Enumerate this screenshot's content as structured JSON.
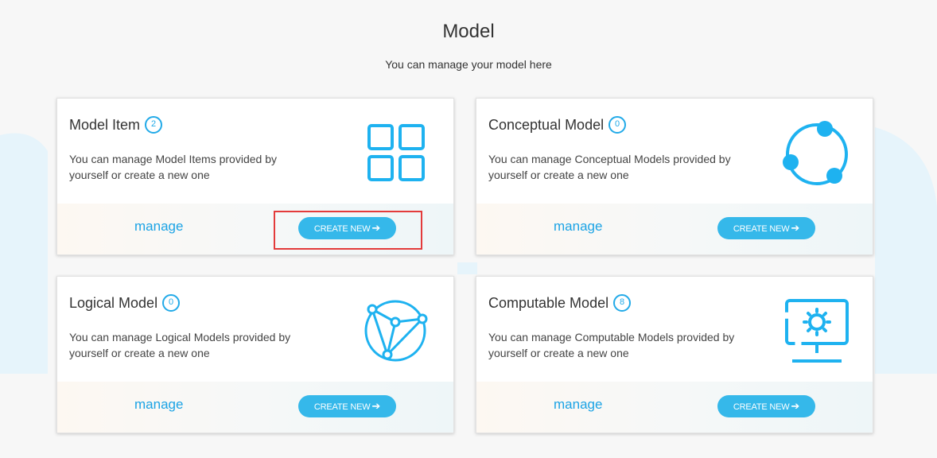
{
  "header": {
    "title": "Model",
    "subtitle": "You can manage your model here"
  },
  "cards": [
    {
      "title": "Model Item",
      "count": "2",
      "description": "You can manage Model Items provided by yourself or create a new one",
      "manage_label": "manage",
      "create_label": "CREATE NEW",
      "icon": "grid-icon"
    },
    {
      "title": "Conceptual Model",
      "count": "0",
      "description": "You can manage Conceptual Models provided by yourself or create a new one",
      "manage_label": "manage",
      "create_label": "CREATE NEW",
      "icon": "circle-nodes-icon"
    },
    {
      "title": "Logical Model",
      "count": "0",
      "description": "You can manage Logical Models provided by yourself or create a new one",
      "manage_label": "manage",
      "create_label": "CREATE NEW",
      "icon": "network-icon"
    },
    {
      "title": "Computable Model",
      "count": "8",
      "description": "You can manage Computable Models provided by yourself or create a new one",
      "manage_label": "manage",
      "create_label": "CREATE NEW",
      "icon": "monitor-gear-icon"
    }
  ],
  "colors": {
    "accent": "#22aae8",
    "button": "#35b8ea",
    "highlight": "#e33b3b"
  }
}
